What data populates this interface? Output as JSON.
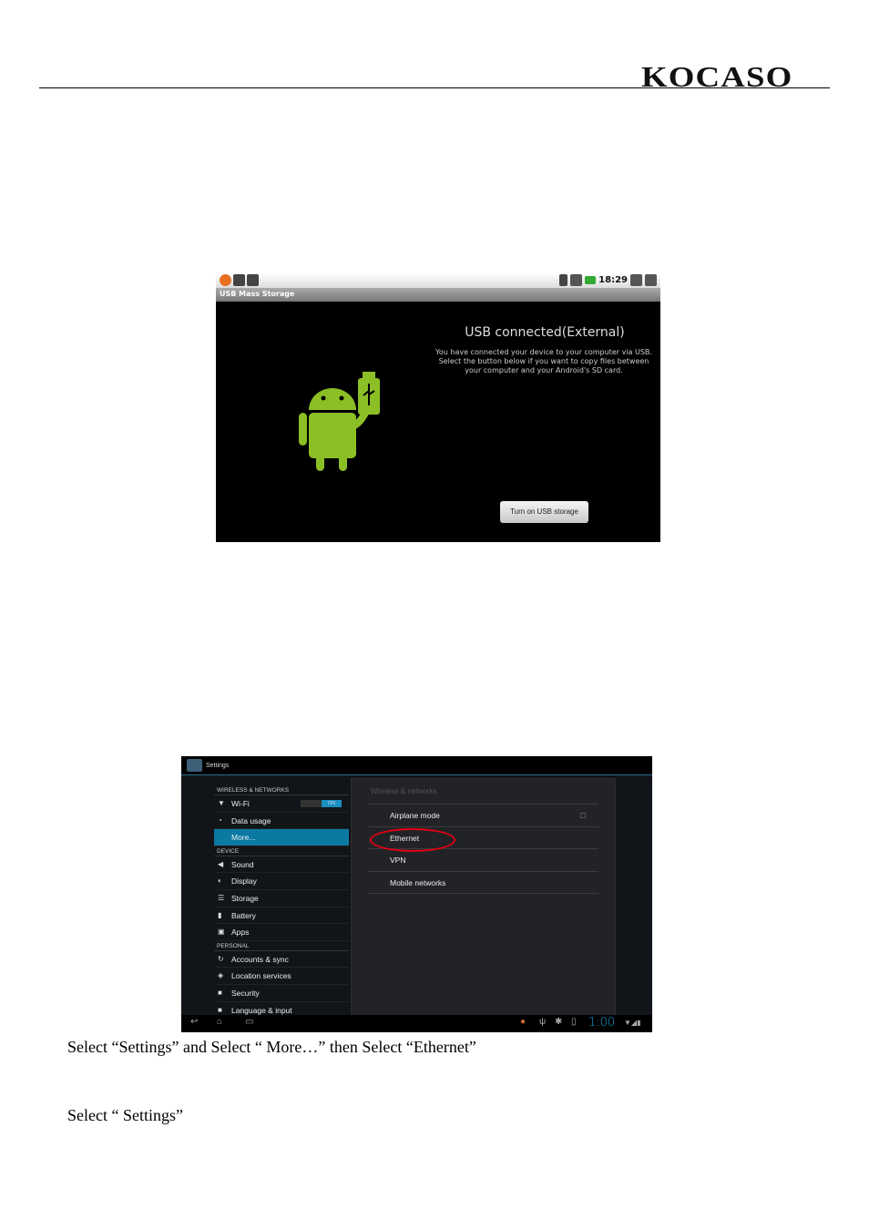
{
  "header": {
    "logo": "KOCASO"
  },
  "usb_screen": {
    "status_time": "18:29",
    "title_bar": "USB Mass Storage",
    "heading": "USB connected(External)",
    "message": "You have connected your device to your computer via USB. Select the button below if you want to copy files between your computer and your Android's SD card.",
    "button": "Turn on USB storage",
    "accent": "#8cbf26"
  },
  "settings_screen": {
    "title": "Settings",
    "sections": [
      {
        "label": "WIRELESS & NETWORKS",
        "items": [
          {
            "label": "Wi-Fi",
            "icon": "wifi-icon",
            "toggle": "ON"
          },
          {
            "label": "Data usage",
            "icon": "data-usage-icon"
          },
          {
            "label": "More...",
            "icon": "",
            "selected": true
          }
        ]
      },
      {
        "label": "DEVICE",
        "items": [
          {
            "label": "Sound",
            "icon": "speaker-icon"
          },
          {
            "label": "Display",
            "icon": "display-icon"
          },
          {
            "label": "Storage",
            "icon": "storage-icon"
          },
          {
            "label": "Battery",
            "icon": "battery-icon"
          },
          {
            "label": "Apps",
            "icon": "apps-icon"
          }
        ]
      },
      {
        "label": "PERSONAL",
        "items": [
          {
            "label": "Accounts & sync",
            "icon": "sync-icon"
          },
          {
            "label": "Location services",
            "icon": "location-icon"
          },
          {
            "label": "Security",
            "icon": "lock-icon"
          },
          {
            "label": "Language & input",
            "icon": "keyboard-icon"
          }
        ]
      }
    ],
    "panel_header": "Wireless & networks",
    "panel_items": [
      "Airplane mode",
      "Ethernet",
      "VPN",
      "Mobile networks"
    ],
    "clock": "1:00",
    "highlight_color": "#e00010",
    "selected_color": "#0a7aa3"
  },
  "captions": [
    "Select “Settings” and Select “ More…” then Select “Ethernet”",
    "Select “ Settings”"
  ]
}
